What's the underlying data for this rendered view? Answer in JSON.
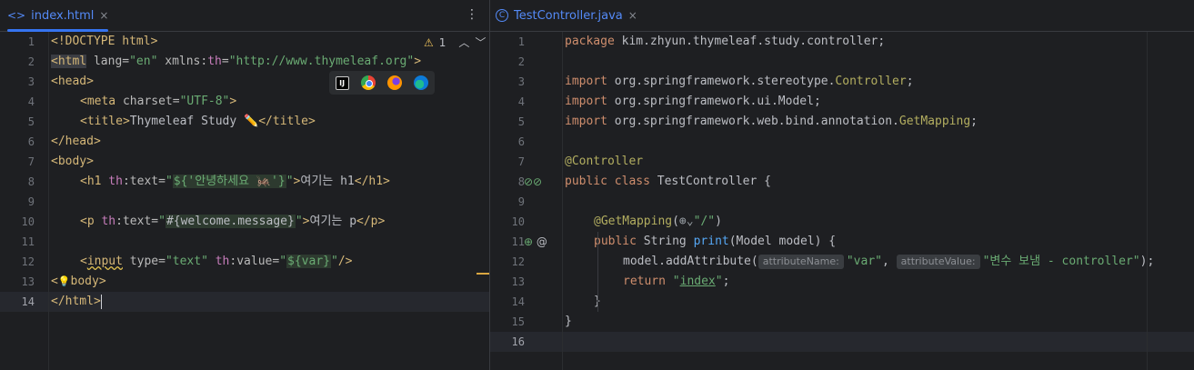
{
  "left": {
    "tab": {
      "icon": "html-code-icon",
      "label": "index.html",
      "close": "×"
    },
    "more": "⋮",
    "inspection": {
      "icon": "warning-triangle-icon",
      "count": "1",
      "up": "⌃",
      "down": "⌄"
    },
    "line_numbers": [
      "1",
      "2",
      "3",
      "4",
      "5",
      "6",
      "7",
      "8",
      "9",
      "10",
      "11",
      "12",
      "13",
      "14"
    ],
    "browser_icons": [
      "intellij-icon",
      "chrome-icon",
      "firefox-icon",
      "edge-icon"
    ],
    "code": {
      "l1": "<!DOCTYPE html>",
      "l2": {
        "open": "<html",
        "a1": " lang=",
        "v1": "\"en\"",
        "a2": " xmlns:",
        "a2b": "th",
        "a2c": "=",
        "v2": "\"http://www.thymeleaf.org\"",
        "close": ">"
      },
      "l3": "<head>",
      "l4": {
        "open": "<meta",
        "a": " charset=",
        "v": "\"UTF-8\"",
        "close": ">"
      },
      "l5": {
        "open": "<title>",
        "text": "Thymeleaf Study ✏️",
        "close": "</title>"
      },
      "l6": "</head>",
      "l7": "<body>",
      "l8": {
        "open": "<h1",
        "ns": " th",
        "a": ":text=",
        "q1": "\"",
        "expr": "${'안녕하세요 🦗'}",
        "q2": "\"",
        "gt": ">",
        "text": "여기는 h1",
        "close": "</h1>"
      },
      "l10": {
        "open": "<p",
        "ns": " th",
        "a": ":text=",
        "q1": "\"",
        "expr": "#{welcome.message}",
        "q2": "\"",
        "gt": ">",
        "text": "여기는 p",
        "close": "</p>"
      },
      "l12": {
        "lt": "<",
        "tag": "input",
        "a1": " type=",
        "v1": "\"text\"",
        "ns": " th",
        "a2": ":value=",
        "q1": "\"",
        "expr": "${var}",
        "q2": "\"",
        "close": "/>"
      },
      "l13": {
        "lt": "<",
        "bulb": "💡",
        "rest": "body>"
      },
      "l14": "</html>"
    }
  },
  "right": {
    "tab": {
      "icon": "java-class-icon",
      "label": "TestController.java",
      "close": "×"
    },
    "line_numbers": [
      "1",
      "2",
      "3",
      "4",
      "5",
      "6",
      "7",
      "8",
      "9",
      "10",
      "11",
      "12",
      "13",
      "14",
      "15",
      "16"
    ],
    "gutter_icons": {
      "l8": "🔎︎🔎︎",
      "l11": "⚲ @"
    },
    "code": {
      "l1": {
        "kw": "package",
        "rest": " kim.zhyun.thymeleaf.study.controller;"
      },
      "l3": {
        "kw": "import",
        "pkg": " org.springframework.stereotype.",
        "an": "Controller",
        "end": ";"
      },
      "l4": {
        "kw": "import",
        "rest": " org.springframework.ui.Model;"
      },
      "l5": {
        "kw": "import",
        "pkg": " org.springframework.web.bind.annotation.",
        "an": "GetMapping",
        "end": ";"
      },
      "l7": "@Controller",
      "l8": {
        "kw": "public class",
        "rest": " TestController {"
      },
      "l10": {
        "an": "@GetMapping",
        "p1": "(",
        "icon": "globe-icon",
        "s": "\"/\"",
        "p2": ")"
      },
      "l11": {
        "kw": "public",
        "t": " String ",
        "fn": "print",
        "rest": "(Model model) {"
      },
      "l12": {
        "pre": "model.addAttribute(",
        "h1": "attributeName:",
        "s1": "\"var\"",
        "comma": ", ",
        "h2": "attributeValue:",
        "s2": "\"변수 보냄 - controller\"",
        "end": ");"
      },
      "l13": {
        "kw": "return",
        "q1": " \"",
        "s": "index",
        "q2": "\"",
        "end": ";"
      },
      "l14": "}",
      "l15": "}"
    }
  }
}
